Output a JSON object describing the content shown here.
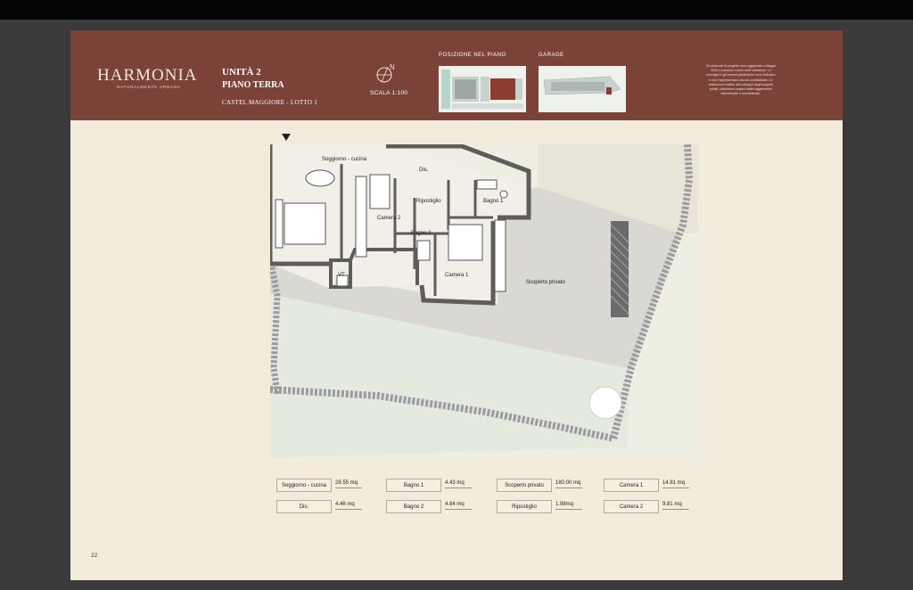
{
  "banner": {
    "logo": "HARMONIA",
    "logo_tagline": "NATURALMENTE URBANA",
    "unit_title": "UNITÀ 2",
    "unit_floor": "PIANO TERRA",
    "location": "CASTEL MAGGIORE - LOTTO 1",
    "compass_letter": "N",
    "scale": "SCALA 1:100",
    "position_label": "POSIZIONE NEL PIANO",
    "garage_label": "GARAGE",
    "disclaimer": "Gli elaborati di progetto sono aggiornati a Maggio 2025 e potranno subire delle variazioni. Le immagini e gli schemi planimetrici sono indicativi e non rappresentano vincolo contrattuale. Le indicazioni relative allo sviluppo degli scoperti privati, potrebbero essere state leggermente sottostimate o sovrastimate."
  },
  "plan": {
    "rooms": {
      "soggiorno": "Soggiorno - cucina",
      "dis": "Dis.",
      "ripostiglio": "Ripostiglio",
      "bagno1": "Bagno 1",
      "camera2": "Camera 2",
      "bagno2": "Bagno 2",
      "camera1": "Camera 1",
      "vt": "VT",
      "scoperto": "Scoperto privato"
    }
  },
  "areas": [
    {
      "name": "Soggiorno - cucina",
      "value": "28.55 mq"
    },
    {
      "name": "Bagno 1",
      "value": "4.43 mq"
    },
    {
      "name": "Scoperto privato",
      "value": "180.00 mq"
    },
    {
      "name": "Camera 1",
      "value": "14.81 mq"
    },
    {
      "name": "Dis.",
      "value": "4.46 mq"
    },
    {
      "name": "Bagno 2",
      "value": "4.84 mq"
    },
    {
      "name": "Ripostiglio",
      "value": "1.98mq"
    },
    {
      "name": "Camera 2",
      "value": "9.81 mq"
    }
  ],
  "page_number": "22",
  "colors": {
    "banner": "#7b4338",
    "page": "#f3ecdc",
    "lawn": "#e7ede1",
    "walls": "#5f5d5b"
  }
}
